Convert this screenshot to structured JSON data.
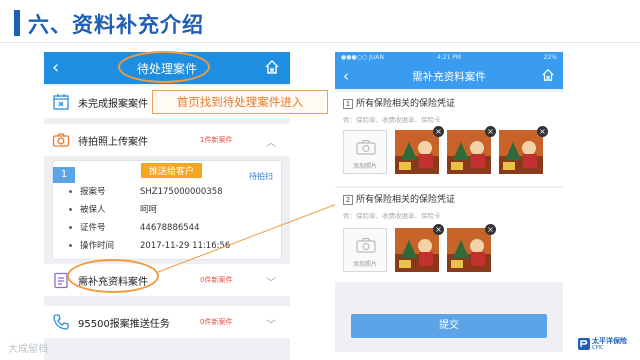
{
  "slide": {
    "title": "六、资料补充介绍"
  },
  "callout": {
    "text": "首页找到待处理案件进入"
  },
  "left_phone": {
    "nav_title": "待处理案件",
    "rows": [
      {
        "label": "未完成报案案件",
        "count": "",
        "chevron": ""
      },
      {
        "label": "待拍照上传案件",
        "count": "1件新案件",
        "chevron": "︿"
      },
      {
        "label": "需补充资料案件",
        "count": "0件新案件",
        "chevron": "﹀"
      },
      {
        "label": "95500报案推送任务",
        "count": "0件新案件",
        "chevron": "﹀"
      }
    ],
    "card": {
      "number": "1",
      "tag": "推送给客户",
      "action": "待拍扫",
      "fields": [
        {
          "key": "报案号",
          "value": "SHZ175000000358"
        },
        {
          "key": "被保人",
          "value": "呵呵"
        },
        {
          "key": "证件号",
          "value": "44678886544"
        },
        {
          "key": "操作时间",
          "value": "2017-11-29 11:16:56"
        }
      ]
    }
  },
  "right_phone": {
    "status": {
      "carrier": "●●●○○ JUAN",
      "time": "4:21 PM",
      "battery": "22%"
    },
    "nav_title": "需补充资料案件",
    "sections": [
      {
        "num": "1",
        "title": "所有保险相关的保险凭证",
        "hint": "例：保险单、收费收据单、保险卡"
      },
      {
        "num": "2",
        "title": "所有保险相关的保险凭证",
        "hint": "例：保险单、收费收据单、保险卡"
      }
    ],
    "add_label": "添加照片",
    "submit": "提交"
  },
  "footer": {
    "watermark": "大成留档",
    "brand_name": "太平洋保险",
    "brand_sub": "CPIC"
  },
  "colors": {
    "brand_blue": "#1d5fb5",
    "nav_blue": "#1e8fe0",
    "accent_orange": "#f19a3e",
    "alert_red": "#e94b3c"
  }
}
